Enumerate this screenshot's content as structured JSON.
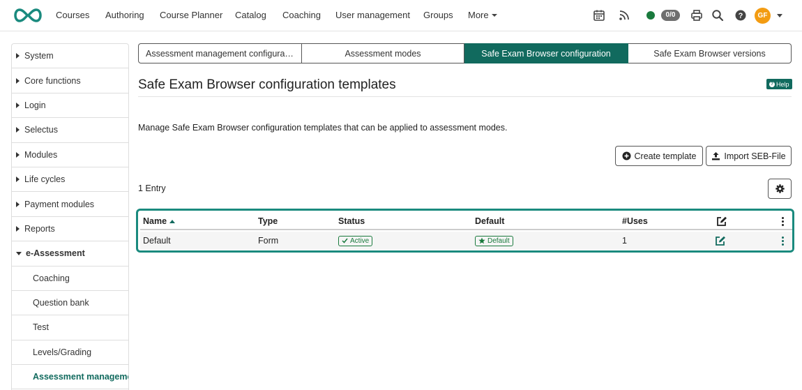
{
  "nav": {
    "items": [
      "Courses",
      "Authoring",
      "Course Planner",
      "Catalog",
      "Coaching",
      "User management",
      "Groups"
    ],
    "more_label": "More",
    "counter": "0/0",
    "avatar_initials": "GF"
  },
  "colors": {
    "brand": "#116a5e",
    "highlight": "#1a8a7e",
    "online": "#1a7a3d",
    "avatar": "#f39c12"
  },
  "sidebar": {
    "items": [
      {
        "label": "System"
      },
      {
        "label": "Core functions"
      },
      {
        "label": "Login"
      },
      {
        "label": "Selectus"
      },
      {
        "label": "Modules"
      },
      {
        "label": "Life cycles"
      },
      {
        "label": "Payment modules"
      },
      {
        "label": "Reports"
      },
      {
        "label": "e-Assessment"
      }
    ],
    "children": [
      {
        "label": "Coaching"
      },
      {
        "label": "Question bank"
      },
      {
        "label": "Test"
      },
      {
        "label": "Levels/Grading"
      },
      {
        "label": "Assessment management"
      }
    ]
  },
  "tabs": [
    {
      "label": "Assessment management configurati…"
    },
    {
      "label": "Assessment modes"
    },
    {
      "label": "Safe Exam Browser configuration"
    },
    {
      "label": "Safe Exam Browser versions"
    }
  ],
  "page": {
    "title": "Safe Exam Browser configuration templates",
    "help_label": "Help",
    "description": "Manage Safe Exam Browser configuration templates that can be applied to assessment modes.",
    "create_label": "Create template",
    "import_label": "Import SEB-File",
    "entries_label": "1 Entry"
  },
  "table": {
    "headers": {
      "name": "Name",
      "type": "Type",
      "status": "Status",
      "default": "Default",
      "uses": "#Uses"
    },
    "rows": [
      {
        "name": "Default",
        "type": "Form",
        "status": "Active",
        "default": "Default",
        "uses": "1"
      }
    ]
  }
}
